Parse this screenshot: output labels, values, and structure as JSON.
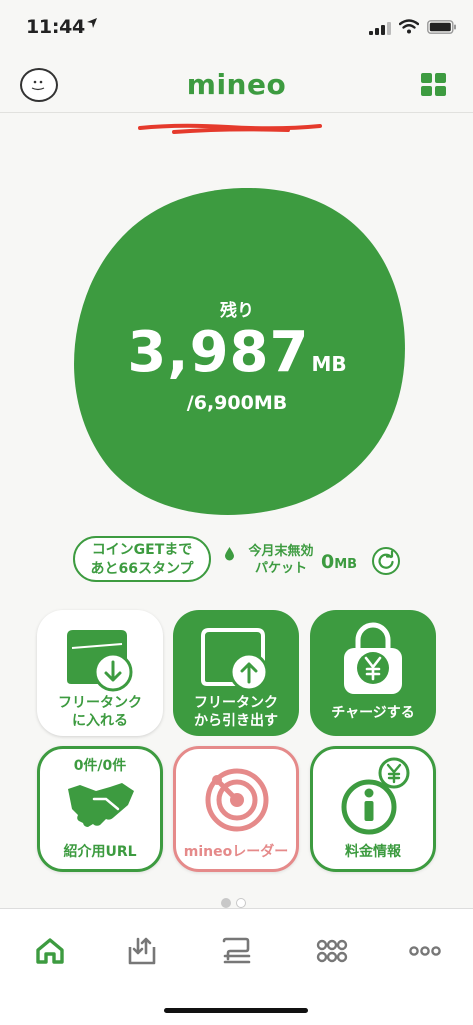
{
  "status_bar": {
    "time": "11:44"
  },
  "header": {
    "brand": "mineo"
  },
  "data_usage": {
    "remaining_label": "残り",
    "remaining_value": "3,987",
    "remaining_unit": "MB",
    "total": "/6,900MB",
    "blob_color": "#3d9b40"
  },
  "coin": {
    "line1": "コインGETまで",
    "line2": "あと66スタンプ"
  },
  "packet": {
    "line1": "今月末無効",
    "line2": "パケット",
    "value": "0",
    "unit": "MB"
  },
  "tiles": {
    "free_tank_in": {
      "line1": "フリータンク",
      "line2": "に入れる"
    },
    "free_tank_out": {
      "line1": "フリータンク",
      "line2": "から引き出す"
    },
    "charge": {
      "line1": "チャージする"
    },
    "referral": {
      "count": "0件/0件",
      "label": "紹介用URL"
    },
    "radar": {
      "label": "mineoレーダー"
    },
    "fee": {
      "label": "料金情報"
    }
  },
  "pager": {
    "pages": 2,
    "current": 1
  },
  "bottom_nav": [
    "home-icon",
    "tray-icon",
    "chat-icon",
    "community-icon",
    "more-icon"
  ],
  "colors": {
    "accent": "#3d9b40",
    "radar": "#e58a8a",
    "background": "#f7f7f5"
  }
}
